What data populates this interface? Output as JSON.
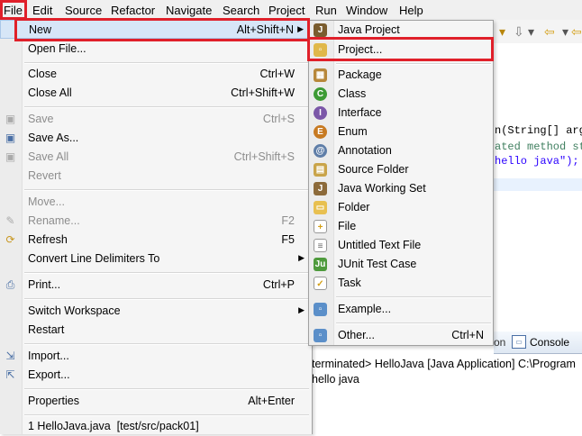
{
  "menubar": {
    "items": [
      "File",
      "Edit",
      "Source",
      "Refactor",
      "Navigate",
      "Search",
      "Project",
      "Run",
      "Window",
      "Help"
    ]
  },
  "file_menu": {
    "new": {
      "label": "New",
      "shortcut": "Alt+Shift+N"
    },
    "open_file": {
      "label": "Open File..."
    },
    "close": {
      "label": "Close",
      "shortcut": "Ctrl+W"
    },
    "close_all": {
      "label": "Close All",
      "shortcut": "Ctrl+Shift+W"
    },
    "save": {
      "label": "Save",
      "shortcut": "Ctrl+S"
    },
    "save_as": {
      "label": "Save As..."
    },
    "save_all": {
      "label": "Save All",
      "shortcut": "Ctrl+Shift+S"
    },
    "revert": {
      "label": "Revert"
    },
    "move": {
      "label": "Move..."
    },
    "rename": {
      "label": "Rename...",
      "shortcut": "F2"
    },
    "refresh": {
      "label": "Refresh",
      "shortcut": "F5"
    },
    "convert": {
      "label": "Convert Line Delimiters To"
    },
    "print": {
      "label": "Print...",
      "shortcut": "Ctrl+P"
    },
    "switch_workspace": {
      "label": "Switch Workspace"
    },
    "restart": {
      "label": "Restart"
    },
    "import": {
      "label": "Import..."
    },
    "export": {
      "label": "Export..."
    },
    "properties": {
      "label": "Properties",
      "shortcut": "Alt+Enter"
    },
    "recent": {
      "label": "1 HelloJava.java  [test/src/pack01]"
    }
  },
  "new_submenu": {
    "java_project": "Java Project",
    "project": "Project...",
    "package": "Package",
    "class": "Class",
    "interface": "Interface",
    "enum": "Enum",
    "annotation": "Annotation",
    "source_folder": "Source Folder",
    "java_working_set": "Java Working Set",
    "folder": "Folder",
    "file": "File",
    "untitled_text_file": "Untitled Text File",
    "junit_test_case": "JUnit Test Case",
    "task": "Task",
    "example": "Example...",
    "other": {
      "label": "Other...",
      "shortcut": "Ctrl+N"
    }
  },
  "editor": {
    "line1": "n(String[] args",
    "line2": "ated method stu",
    "line3": "hello java\");"
  },
  "console": {
    "tab_partial": "on",
    "tab_label": "Console",
    "status": "terminated> HelloJava [Java Application] C:\\Program",
    "output": "hello java"
  },
  "colors": {
    "highlight_red": "#e0202a",
    "selection": "#d7e6f7",
    "disabled_text": "#8d8d8d"
  }
}
